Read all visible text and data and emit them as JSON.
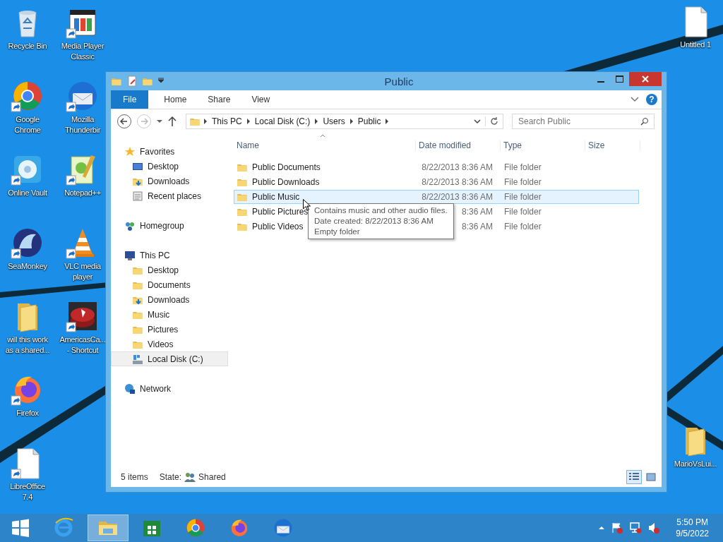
{
  "desktop_columns": [
    [
      {
        "label": "Recycle Bin",
        "kind": "recycle-bin",
        "shortcut": false
      },
      {
        "label": "Google\nChrome",
        "kind": "chrome",
        "shortcut": true
      },
      {
        "label": "Online Vault",
        "kind": "vault",
        "shortcut": true
      },
      {
        "label": "SeaMonkey",
        "kind": "seamonkey",
        "shortcut": true
      },
      {
        "label": "will this work\nas a shared...",
        "kind": "folder",
        "shortcut": false
      },
      {
        "label": "Firefox",
        "kind": "firefox",
        "shortcut": true
      },
      {
        "label": "LibreOffice\n7.4",
        "kind": "document",
        "shortcut": true
      }
    ],
    [
      {
        "label": "Media Player\nClassic",
        "kind": "media-player",
        "shortcut": true
      },
      {
        "label": "Mozilla\nThunderbir",
        "kind": "thunderbird",
        "shortcut": true
      },
      {
        "label": "Notepad++",
        "kind": "notepad",
        "shortcut": true
      },
      {
        "label": "VLC media\nplayer",
        "kind": "vlc",
        "shortcut": true
      },
      {
        "label": "AmericasCa...\n- Shortcut",
        "kind": "chip",
        "shortcut": true
      }
    ]
  ],
  "desktop_right": [
    {
      "label": "Untitled 1",
      "kind": "document",
      "shortcut": false
    },
    {
      "label": "MarioVsLui...",
      "kind": "folder",
      "shortcut": false
    }
  ],
  "window": {
    "title": "Public",
    "ribbon_tabs": [
      {
        "label": "File",
        "kind": "file"
      },
      {
        "label": "Home",
        "kind": "tab"
      },
      {
        "label": "Share",
        "kind": "tab"
      },
      {
        "label": "View",
        "kind": "tab"
      }
    ],
    "help_label": "?",
    "address_path": [
      "This PC",
      "Local Disk (C:)",
      "Users",
      "Public"
    ],
    "search": {
      "placeholder": "Search Public"
    },
    "nav": [
      {
        "label": "Favorites",
        "kind": "star",
        "selected": false,
        "children": [
          {
            "label": "Desktop",
            "kind": "monitor",
            "selected": false
          },
          {
            "label": "Downloads",
            "kind": "download",
            "selected": false
          },
          {
            "label": "Recent places",
            "kind": "recent",
            "selected": false
          }
        ]
      },
      {
        "label": "Homegroup",
        "kind": "homegroup",
        "selected": false
      },
      {
        "label": "This PC",
        "kind": "computer",
        "selected": false,
        "children": [
          {
            "label": "Desktop",
            "kind": "folder",
            "selected": false
          },
          {
            "label": "Documents",
            "kind": "folder",
            "selected": false
          },
          {
            "label": "Downloads",
            "kind": "download",
            "selected": false
          },
          {
            "label": "Music",
            "kind": "folder",
            "selected": false
          },
          {
            "label": "Pictures",
            "kind": "folder",
            "selected": false
          },
          {
            "label": "Videos",
            "kind": "folder",
            "selected": false
          },
          {
            "label": "Local Disk (C:)",
            "kind": "drive",
            "selected": true
          }
        ]
      },
      {
        "label": "Network",
        "kind": "network",
        "selected": false
      }
    ],
    "columns": [
      "Name",
      "Date modified",
      "Type",
      "Size"
    ],
    "rows": [
      {
        "name": "Public Documents",
        "date": "8/22/2013 8:36 AM",
        "type": "File folder",
        "selected": false
      },
      {
        "name": "Public Downloads",
        "date": "8/22/2013 8:36 AM",
        "type": "File folder",
        "selected": false
      },
      {
        "name": "Public Music",
        "date": "8/22/2013 8:36 AM",
        "type": "File folder",
        "selected": true
      },
      {
        "name": "Public Pictures",
        "date": "8:36 AM",
        "type": "File folder",
        "selected": false
      },
      {
        "name": "Public Videos",
        "date": "8:36 AM",
        "type": "File folder",
        "selected": false
      }
    ],
    "tooltip": [
      "Contains music and other audio files.",
      "Date created: 8/22/2013 8:36 AM",
      "Empty folder"
    ],
    "status": {
      "count": "5 items",
      "state_label": "State:",
      "state_value": "Shared"
    },
    "views": [
      {
        "kind": "details",
        "selected": true
      },
      {
        "kind": "large-icons",
        "selected": false
      }
    ]
  },
  "taskbar": {
    "apps": [
      {
        "kind": "ie",
        "selected": false
      },
      {
        "kind": "explorer",
        "selected": true
      },
      {
        "kind": "store",
        "selected": false
      },
      {
        "kind": "chrome",
        "selected": false
      },
      {
        "kind": "firefox",
        "selected": false
      },
      {
        "kind": "thunderbird",
        "selected": false
      }
    ],
    "time": "5:50 PM",
    "date": "9/5/2022"
  }
}
